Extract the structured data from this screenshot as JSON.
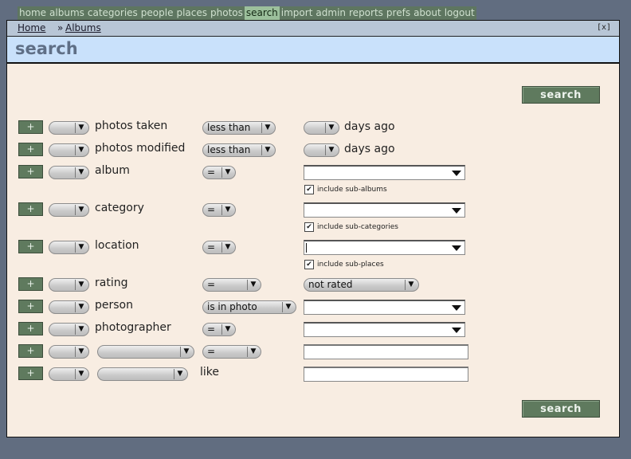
{
  "nav": {
    "items": [
      "home",
      "albums",
      "categories",
      "people",
      "places",
      "photos",
      "search",
      "import",
      "admin",
      "reports",
      "prefs",
      "about",
      "logout"
    ],
    "active": "search"
  },
  "breadcrumb": {
    "home": "Home",
    "separator": "»",
    "albums": "Albums",
    "close": "[x]"
  },
  "page": {
    "title": "search"
  },
  "search_button": "search",
  "plus_label": "+",
  "rows": {
    "photos_taken": {
      "label": "photos taken",
      "op": "less than",
      "value_suffix": "days ago"
    },
    "photos_modified": {
      "label": "photos modified",
      "op": "less than",
      "value_suffix": "days ago"
    },
    "album": {
      "label": "album",
      "op": "=",
      "checkbox": "include sub-albums",
      "checked": true
    },
    "category": {
      "label": "category",
      "op": "=",
      "checkbox": "include sub-categories",
      "checked": true
    },
    "location": {
      "label": "location",
      "op": "=",
      "checkbox": "include sub-places",
      "checked": true
    },
    "rating": {
      "label": "rating",
      "op": "=",
      "value": "not rated"
    },
    "person": {
      "label": "person",
      "op": "is in photo"
    },
    "photographer": {
      "label": "photographer",
      "op": "="
    },
    "custom1": {
      "op": "="
    },
    "custom2": {
      "op_text": "like"
    }
  },
  "icons": {
    "dropdown": "▼",
    "checkmark": "✔"
  },
  "colors": {
    "nav_bg": "#5e7660",
    "nav_active": "#9cc09c",
    "button": "#5f7a5e",
    "title": "#5f6f86",
    "title_bg": "#c9e1fb",
    "panel_bg": "#f8ede2"
  }
}
